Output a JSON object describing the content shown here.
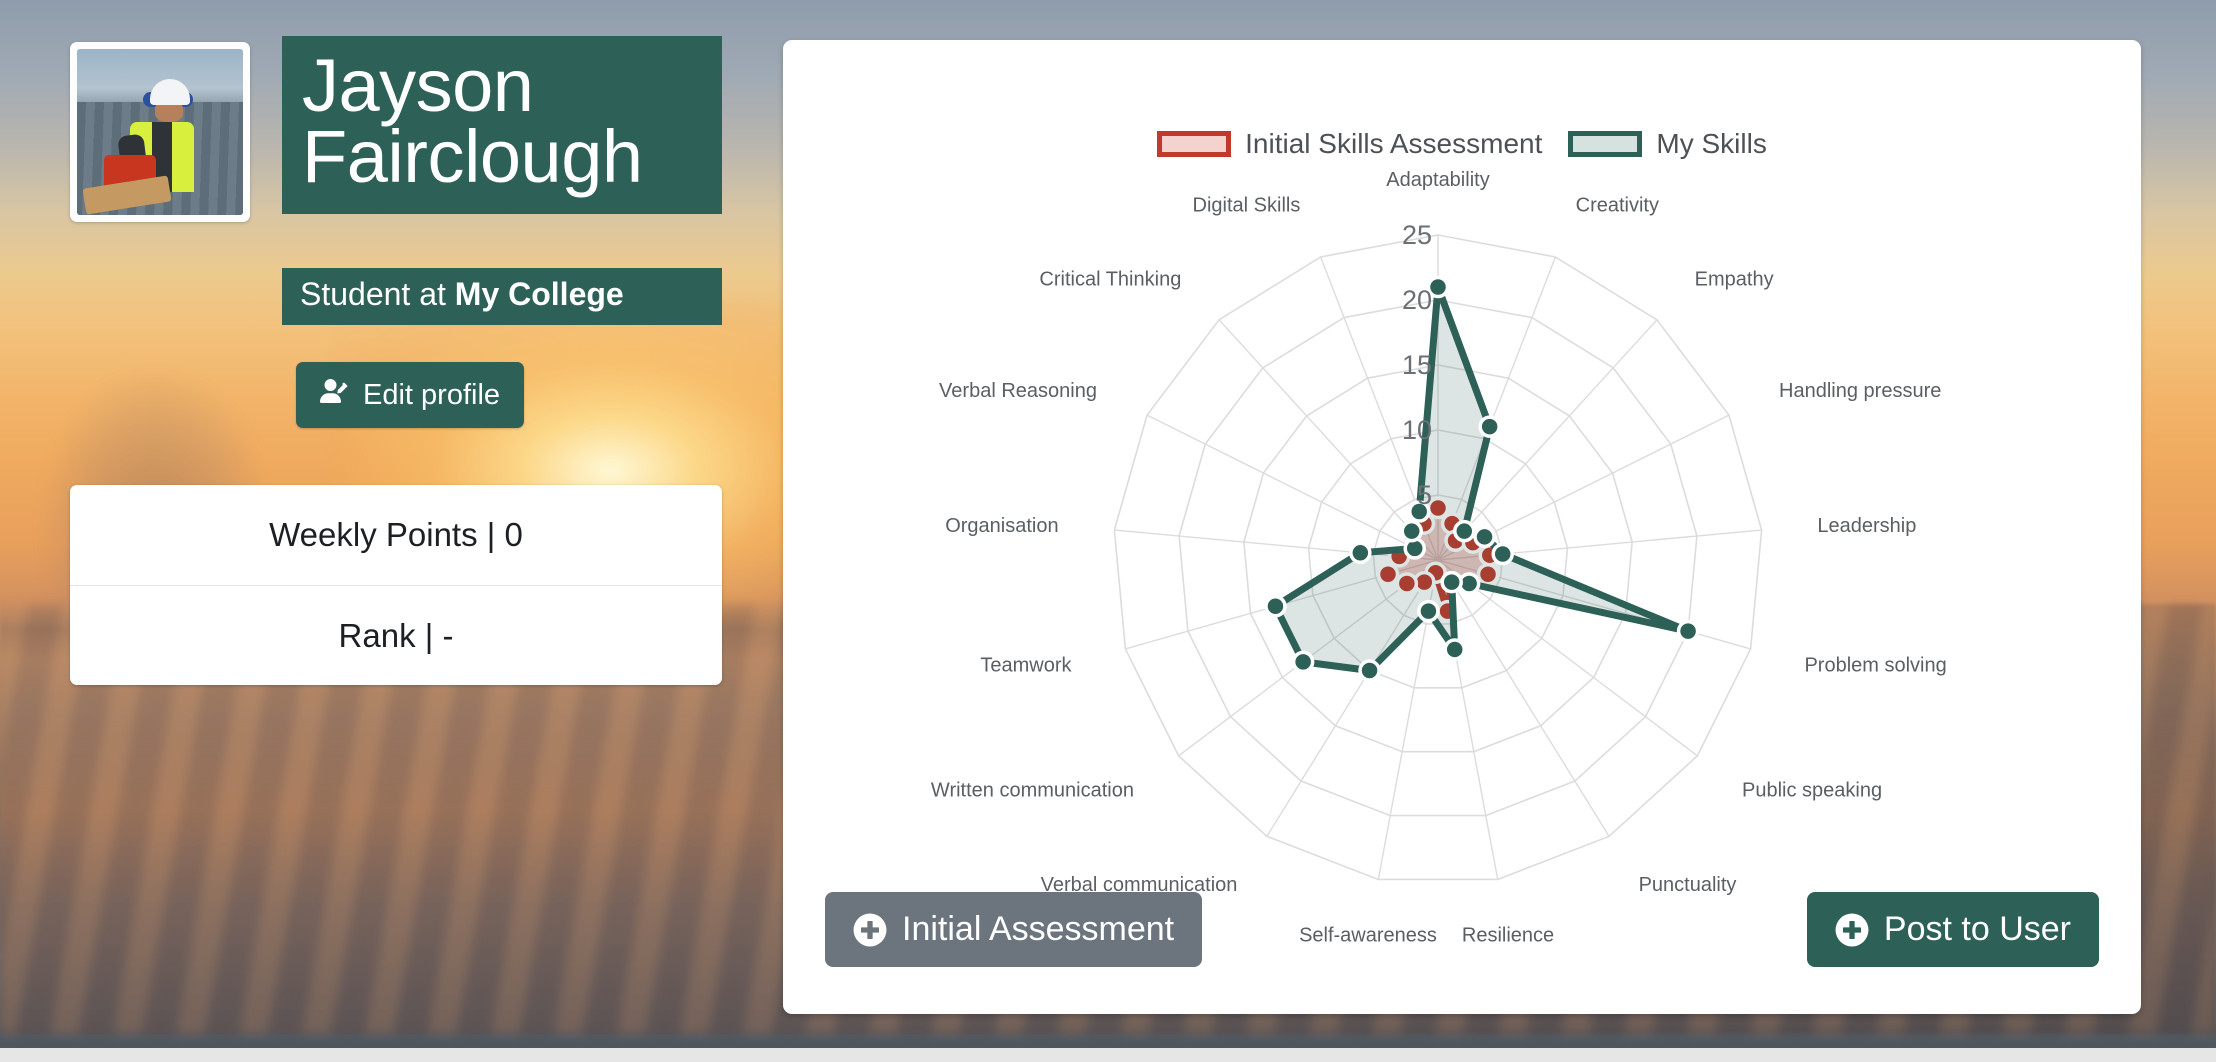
{
  "profile": {
    "avatar_alt": "user-photo",
    "name": "Jayson Fairclough",
    "role_prefix": "Student at ",
    "role_org": "My College",
    "edit_button_label": "Edit profile",
    "edit_button_icon": "user-edit-icon"
  },
  "stats": {
    "rows": [
      {
        "label": "Weekly Points",
        "separator": "|",
        "value": "0",
        "text": "Weekly Points | 0"
      },
      {
        "label": "Rank",
        "separator": "|",
        "value": "-",
        "text": "Rank | -"
      }
    ]
  },
  "chart_card": {
    "initial_assessment_button": {
      "label": "Initial Assessment",
      "icon": "plus-circle-icon",
      "color": "#6c757d"
    },
    "post_to_user_button": {
      "label": "Post to User",
      "icon": "plus-circle-icon",
      "color": "#2d6057"
    }
  },
  "chart_data": {
    "type": "radar",
    "title": "",
    "legend_position": "top",
    "grid": true,
    "rlim": [
      0,
      25
    ],
    "rticks": [
      5,
      10,
      15,
      20,
      25
    ],
    "rtick_labels": [
      "5",
      "10",
      "15",
      "20",
      "25"
    ],
    "categories": [
      "Adaptability",
      "Creativity",
      "Empathy",
      "Handling pressure",
      "Leadership",
      "Problem solving",
      "Public speaking",
      "Punctuality",
      "Resilience",
      "Self-awareness",
      "Verbal communication",
      "Written communication",
      "Teamwork",
      "Organisation",
      "Verbal Reasoning",
      "Critical Thinking",
      "Digital Skills"
    ],
    "series": [
      {
        "name": "Initial Skills Assessment",
        "color": "#c0392b",
        "fill": "#c0392b",
        "fill_opacity": 0.28,
        "values": [
          4,
          3,
          2,
          3,
          4,
          4,
          3,
          2,
          4,
          1,
          2,
          3,
          4,
          3,
          2,
          3,
          3
        ]
      },
      {
        "name": "My Skills",
        "color": "#2d6057",
        "fill": "#2d6057",
        "fill_opacity": 0.16,
        "values": [
          21,
          11,
          3,
          4,
          5,
          20,
          3,
          2,
          7,
          4,
          10,
          13,
          13,
          6,
          2,
          3,
          4
        ]
      }
    ]
  }
}
